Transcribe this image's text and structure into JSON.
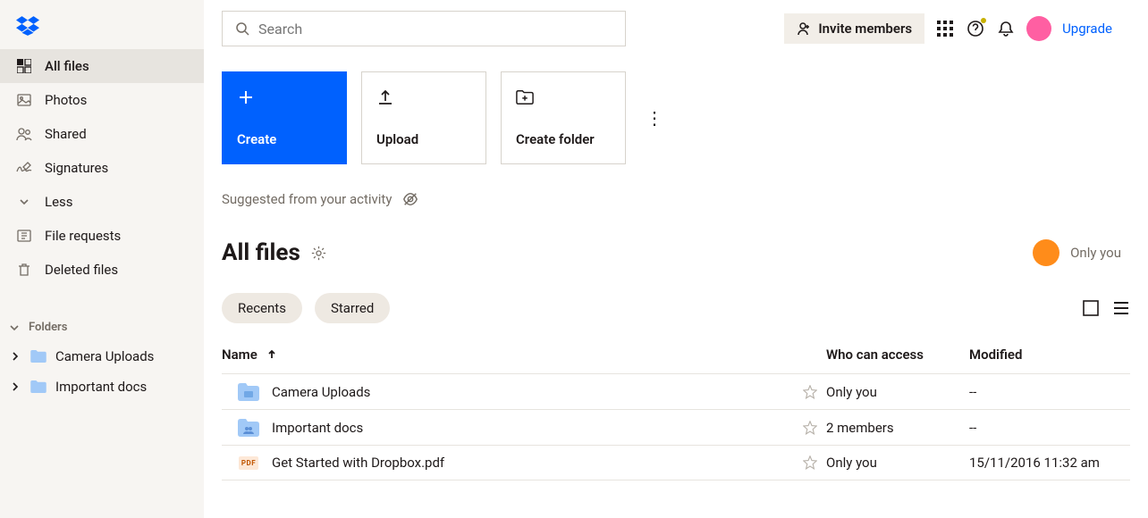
{
  "sidebar": {
    "items": [
      {
        "label": "All files",
        "icon": "tiles-icon",
        "active": true
      },
      {
        "label": "Photos",
        "icon": "image-icon"
      },
      {
        "label": "Shared",
        "icon": "people-icon"
      },
      {
        "label": "Signatures",
        "icon": "signature-icon"
      },
      {
        "label": "Less",
        "icon": "chevron-down-icon"
      },
      {
        "label": "File requests",
        "icon": "inbox-icon"
      },
      {
        "label": "Deleted files",
        "icon": "trash-icon"
      }
    ],
    "folders_heading": "Folders",
    "folders": [
      {
        "label": "Camera Uploads"
      },
      {
        "label": "Important docs"
      }
    ]
  },
  "header": {
    "search_placeholder": "Search",
    "invite_label": "Invite members",
    "upgrade_label": "Upgrade"
  },
  "actions": {
    "create": "Create",
    "upload": "Upload",
    "create_folder": "Create folder"
  },
  "suggested_label": "Suggested from your activity",
  "page_title": "All files",
  "access_summary": "Only you",
  "filters": {
    "recents": "Recents",
    "starred": "Starred"
  },
  "columns": {
    "name": "Name",
    "access": "Who can access",
    "modified": "Modified"
  },
  "rows": [
    {
      "type": "folder-blue",
      "name": "Camera Uploads",
      "access": "Only you",
      "modified": "--"
    },
    {
      "type": "folder-shared",
      "name": "Important docs",
      "access": "2 members",
      "modified": "--"
    },
    {
      "type": "pdf",
      "name": "Get Started with Dropbox.pdf",
      "access": "Only you",
      "modified": "15/11/2016 11:32 am"
    }
  ]
}
